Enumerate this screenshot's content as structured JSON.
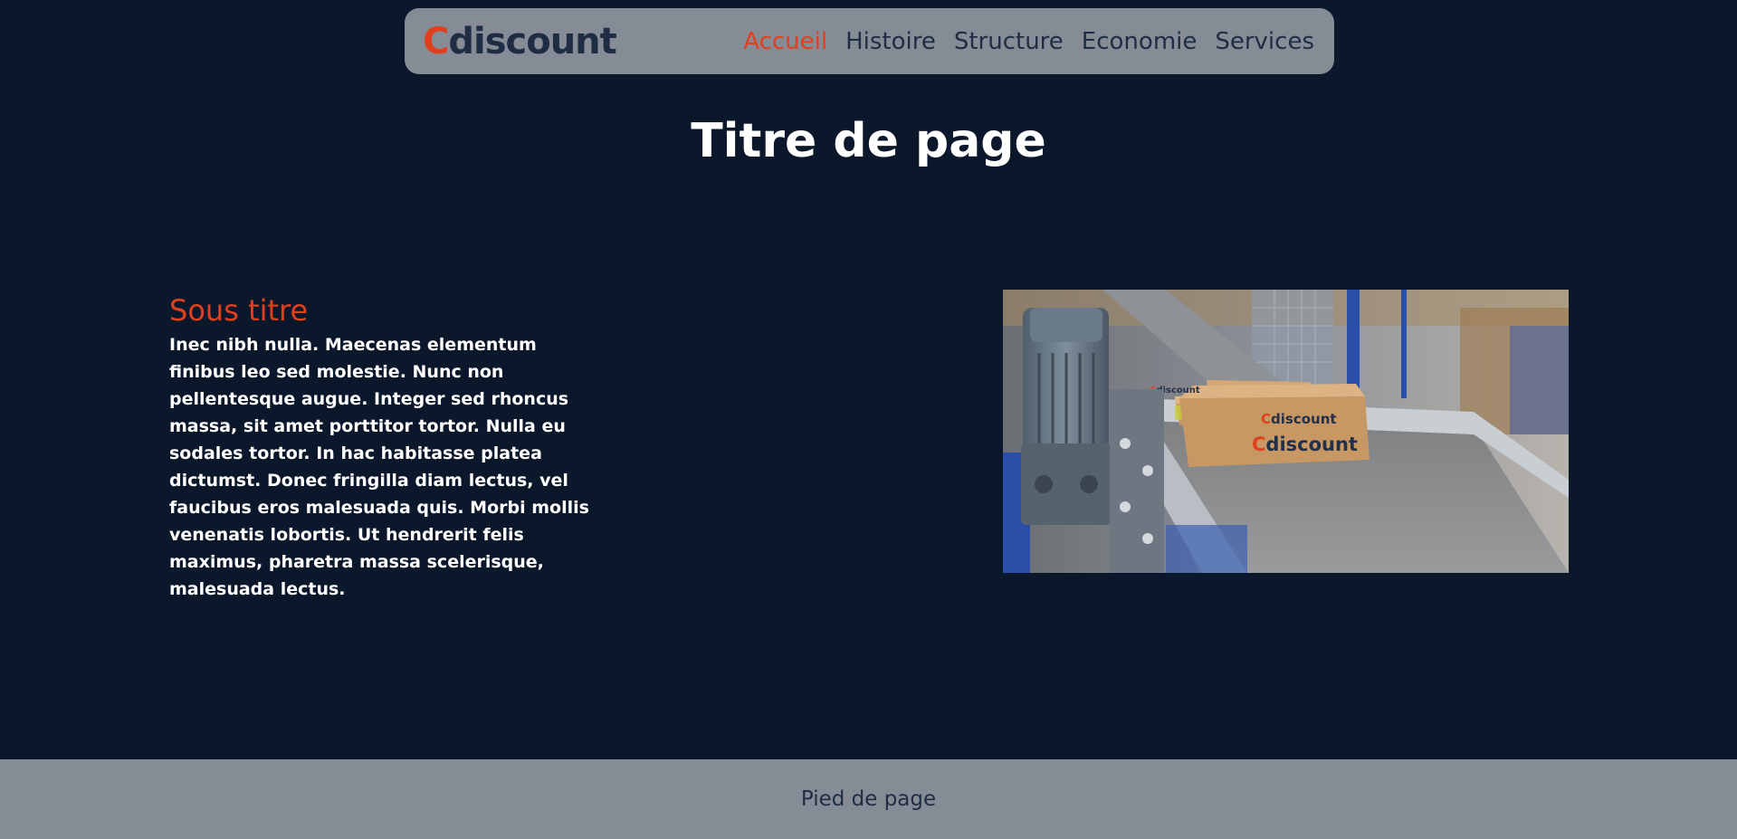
{
  "header": {
    "logo": {
      "first_letter": "C",
      "rest": "discount"
    },
    "nav": [
      {
        "label": "Accueil",
        "active": true
      },
      {
        "label": "Histoire",
        "active": false
      },
      {
        "label": "Structure",
        "active": false
      },
      {
        "label": "Economie",
        "active": false
      },
      {
        "label": "Services",
        "active": false
      }
    ]
  },
  "main": {
    "title": "Titre de page",
    "subtitle": "Sous titre",
    "paragraph": "Inec nibh nulla. Maecenas elementum finibus leo sed molestie. Nunc non pellentesque augue. Integer sed rhoncus massa, sit amet porttitor tortor. Nulla eu sodales tortor. In hac habitasse platea dictumst. Donec fringilla diam lectus, vel faucibus eros malesuada quis. Morbi mollis venenatis lobortis. Ut hendrerit felis maximus, pharetra massa scelerisque, malesuada lectus.",
    "image": {
      "box_text_small": "discount",
      "box_text_small_c": "C",
      "box_text_large": "discount",
      "box_text_large_c": "C"
    }
  },
  "footer": {
    "text": "Pied de page"
  },
  "colors": {
    "background": "#0b172a",
    "navbar": "#868c96",
    "accent": "#e0401e",
    "dark_text": "#1f2d44",
    "light_text": "#ffffff"
  }
}
